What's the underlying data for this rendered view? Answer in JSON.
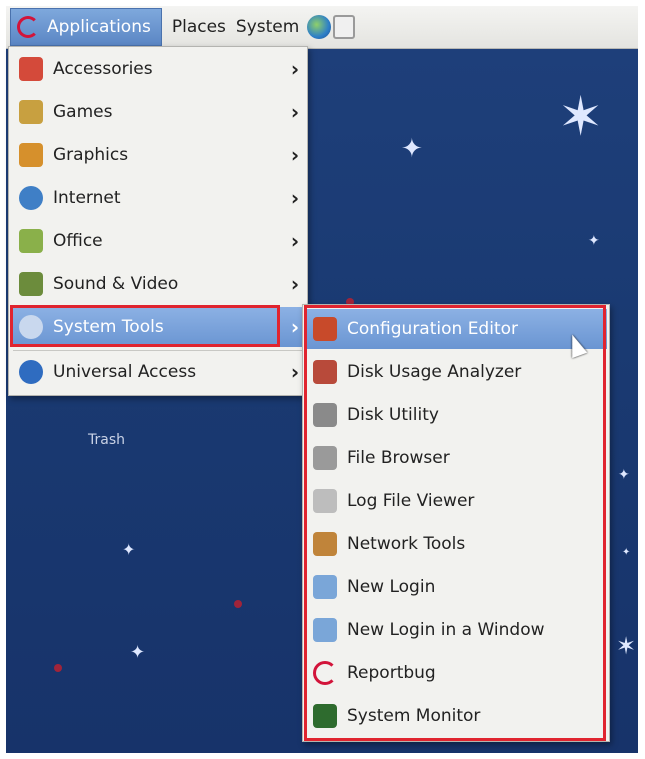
{
  "panel": {
    "applications_label": "Applications",
    "places_label": "Places",
    "system_label": "System"
  },
  "desktop": {
    "trash_label": "Trash"
  },
  "main_menu": {
    "items": [
      {
        "label": "Accessories",
        "icon": "accessories-icon",
        "color": "#d44a3a"
      },
      {
        "label": "Games",
        "icon": "games-icon",
        "color": "#c8a040"
      },
      {
        "label": "Graphics",
        "icon": "graphics-icon",
        "color": "#d6902c"
      },
      {
        "label": "Internet",
        "icon": "internet-icon",
        "color": "#3f7fc6"
      },
      {
        "label": "Office",
        "icon": "office-icon",
        "color": "#8ab04a"
      },
      {
        "label": "Sound & Video",
        "icon": "sound-video-icon",
        "color": "#6c8c3c"
      },
      {
        "label": "System Tools",
        "icon": "system-tools-icon",
        "color": "#7a9cd0"
      },
      {
        "label": "Universal Access",
        "icon": "universal-access-icon",
        "color": "#2f6cc0"
      }
    ]
  },
  "sub_menu": {
    "items": [
      {
        "label": "Configuration Editor",
        "icon": "configuration-editor-icon",
        "color": "#c84a2a"
      },
      {
        "label": "Disk Usage Analyzer",
        "icon": "disk-usage-analyzer-icon",
        "color": "#b84a3a"
      },
      {
        "label": "Disk Utility",
        "icon": "disk-utility-icon",
        "color": "#8a8a8a"
      },
      {
        "label": "File Browser",
        "icon": "file-browser-icon",
        "color": "#9a9a9a"
      },
      {
        "label": "Log File Viewer",
        "icon": "log-file-viewer-icon",
        "color": "#bdbdbd"
      },
      {
        "label": "Network Tools",
        "icon": "network-tools-icon",
        "color": "#c0843a"
      },
      {
        "label": "New Login",
        "icon": "new-login-icon",
        "color": "#7aa6d8"
      },
      {
        "label": "New Login in a Window",
        "icon": "new-login-window-icon",
        "color": "#7aa6d8"
      },
      {
        "label": "Reportbug",
        "icon": "reportbug-icon",
        "color": "#d2143a"
      },
      {
        "label": "System Monitor",
        "icon": "system-monitor-icon",
        "color": "#2e6b2e"
      }
    ]
  },
  "accent_color": "#7ea8dc",
  "highlight_color": "#e0242f"
}
